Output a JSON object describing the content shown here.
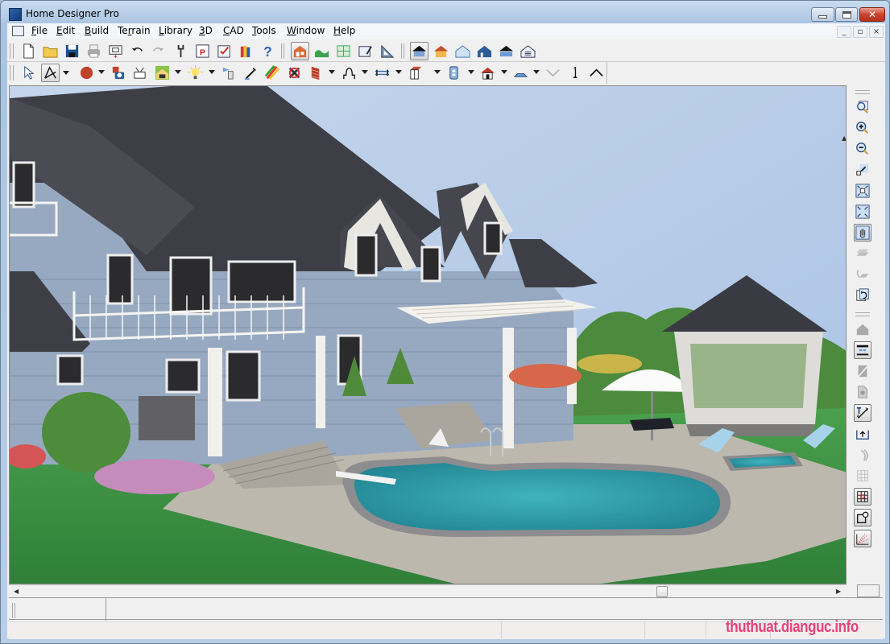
{
  "window": {
    "title": "Home Designer Pro",
    "controls": {
      "minimize": "minimize",
      "maximize": "maximize",
      "close": "close"
    }
  },
  "menubar": {
    "items": [
      {
        "label": "File",
        "accel": "F"
      },
      {
        "label": "Edit",
        "accel": "E"
      },
      {
        "label": "Build",
        "accel": "B"
      },
      {
        "label": "Terrain",
        "accel": "r"
      },
      {
        "label": "Library",
        "accel": "L"
      },
      {
        "label": "3D",
        "accel": "3"
      },
      {
        "label": "CAD",
        "accel": "C"
      },
      {
        "label": "Tools",
        "accel": "T"
      },
      {
        "label": "Window",
        "accel": "W"
      },
      {
        "label": "Help",
        "accel": "H"
      }
    ],
    "mdi_controls": [
      "_",
      "▫",
      "×"
    ]
  },
  "toolbar_top": {
    "file_group": [
      "new-file-icon",
      "open-folder-icon",
      "save-icon",
      "print-icon",
      "plot-icon",
      "undo-icon",
      "redo-icon",
      "preferences-wrench-icon",
      "print-preview-icon",
      "checklist-icon",
      "library-books-icon",
      "help-icon"
    ],
    "view_group": [
      "3d-view-house-icon",
      "terrain-view-icon",
      "floor-plan-icon",
      "layout-sheet-icon",
      "cad-triangle-icon"
    ],
    "camera_group": [
      "full-camera-icon",
      "perspective-view-icon",
      "glass-house-icon",
      "exterior-view-icon",
      "cross-section-icon",
      "room-data-icon"
    ]
  },
  "toolbar_bottom": {
    "tools": [
      "select-arrow-icon",
      "edit-handles-icon",
      "color-ball-icon",
      "material-camera-icon",
      "plot-plan-icon",
      "house-view-icon",
      "light-bulb-icon",
      "paint-bucket-icon",
      "eyedropper-icon",
      "material-painter-rainbow-icon",
      "delete-objects-icon",
      "wall-brick-icon",
      "arch-opening-icon",
      "railing-icon",
      "cabinet-icon",
      "outlet-icon",
      "house-exterior-icon",
      "roof-plane-icon",
      "down-chevron-icon",
      "floor-level-icon",
      "up-chevron-icon"
    ]
  },
  "right_toolbar": {
    "zoom_tools": [
      "zoom-icon",
      "zoom-in-icon",
      "zoom-out-icon",
      "undo-zoom-icon",
      "fill-window-icon",
      "fill-window-building-icon",
      "pan-hand-icon",
      "layer-icon",
      "swap-view-icon",
      "refresh-view-icon"
    ],
    "edit_tools": [
      "roof-icon",
      "rebuild-walls-icon",
      "wall-icon",
      "door-icon",
      "text-dimension-icon",
      "elevation-marker-icon",
      "sun-angle-icon",
      "grid-icon",
      "snap-grid-icon",
      "object-snap-icon",
      "camera-sweep-icon"
    ]
  },
  "viewport": {
    "scene": "3D rendering of blue two-story house with patio, kidney-shaped pool, hot tub, gazebo and landscaping",
    "scroll_h_fraction": 0.8
  },
  "status_bar": {
    "cells": [
      "",
      "",
      "",
      ""
    ]
  },
  "watermark": "thuthuat.dianguc.info",
  "colors": {
    "sky": "#b9cde6",
    "roof": "#3e3f46",
    "siding": "#97a9c0",
    "grass": "#3e9143",
    "patio": "#bcb7ae",
    "pool": "#2e9ca6",
    "watermark": "#e4437a"
  }
}
